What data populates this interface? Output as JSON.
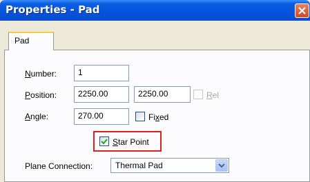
{
  "window": {
    "title": "Properties - Pad"
  },
  "tabs": [
    {
      "label": "Pad",
      "active": true
    }
  ],
  "form": {
    "number": {
      "label": "Number:",
      "mnemonic": "N",
      "rest": "umber:",
      "value": "1"
    },
    "position": {
      "label": "Position:",
      "mnemonic": "P",
      "rest": "osition:",
      "x_value": "2250.00",
      "y_value": "2250.00"
    },
    "rel": {
      "label": "Rel",
      "mnemonic": "R",
      "rest": "el",
      "checked": false,
      "enabled": false
    },
    "angle": {
      "label": "Angle:",
      "mnemonic": "A",
      "rest": "ngle:",
      "value": "270.00"
    },
    "fixed": {
      "label": "Fixed",
      "pre": "Fi",
      "mnemonic": "x",
      "rest": "ed",
      "checked": false
    },
    "star_point": {
      "label": "Star Point",
      "mnemonic": "S",
      "rest": "tar Point",
      "checked": true
    },
    "plane_connection": {
      "label": "Plane Connection:",
      "selected": "Thermal Pad"
    }
  },
  "colors": {
    "highlight_outline": "#e0201c",
    "titlebar": "#0454dd"
  },
  "icons": {
    "close": "close-icon",
    "dropdown": "chevron-down-icon",
    "check": "checkmark-icon"
  }
}
